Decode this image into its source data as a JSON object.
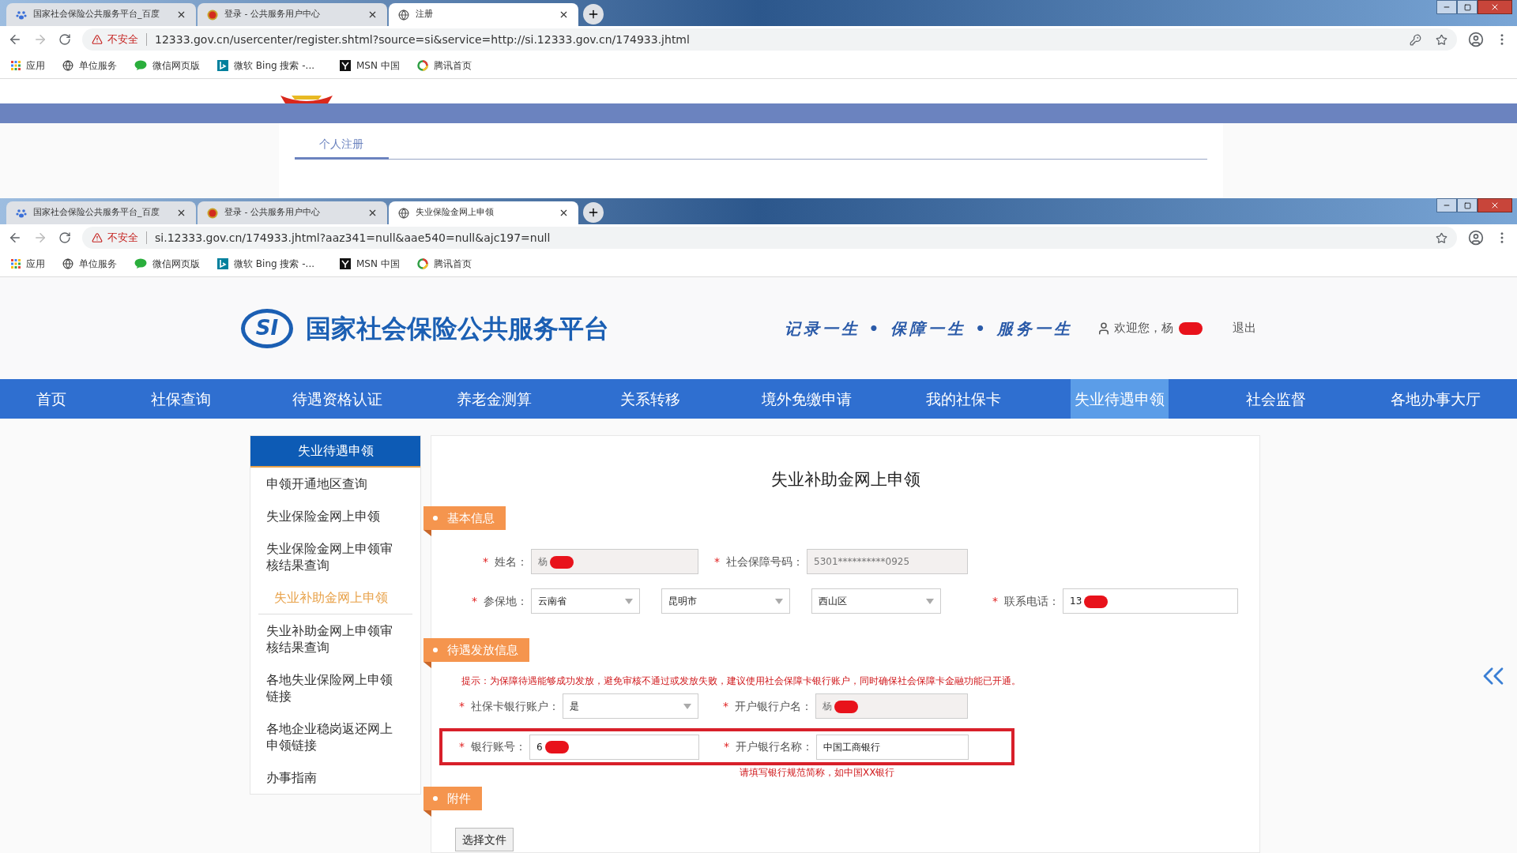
{
  "windows": [
    {
      "tabs": [
        {
          "title": "国家社会保险公共服务平台_百度",
          "selected": false
        },
        {
          "title": "登录 - 公共服务用户中心",
          "selected": false
        },
        {
          "title": "注册",
          "selected": true
        }
      ],
      "address_bar": {
        "security": "不安全",
        "url": "12333.gov.cn/usercenter/register.shtml?source=si&service=http://si.12333.gov.cn/174933.jhtml"
      },
      "bookmarks": [
        "应用",
        "单位服务",
        "微信网页版",
        "微软 Bing 搜索 -...",
        "MSN 中国",
        "腾讯首页"
      ],
      "page": {
        "tabs": [
          {
            "label": "个人注册",
            "selected": true
          }
        ]
      }
    },
    {
      "tabs": [
        {
          "title": "国家社会保险公共服务平台_百度",
          "selected": false
        },
        {
          "title": "登录 - 公共服务用户中心",
          "selected": false
        },
        {
          "title": "失业保险金网上申领",
          "selected": true
        }
      ],
      "address_bar": {
        "security": "不安全",
        "url": "si.12333.gov.cn/174933.jhtml?aaz341=null&aae540=null&ajc197=null"
      },
      "bookmarks": [
        "应用",
        "单位服务",
        "微信网页版",
        "微软 Bing 搜索 -...",
        "MSN 中国",
        "腾讯首页"
      ]
    }
  ],
  "site": {
    "logo": "SI",
    "name": "国家社会保险公共服务平台",
    "slogan": "记录一生 • 保障一生 • 服务一生",
    "welcome": "欢迎您，杨",
    "logout": "退出",
    "nav": [
      {
        "label": "首页",
        "selected": false
      },
      {
        "label": "社保查询",
        "selected": false
      },
      {
        "label": "待遇资格认证",
        "selected": false
      },
      {
        "label": "养老金测算",
        "selected": false
      },
      {
        "label": "关系转移",
        "selected": false
      },
      {
        "label": "境外免缴申请",
        "selected": false
      },
      {
        "label": "我的社保卡",
        "selected": false
      },
      {
        "label": "失业待遇申领",
        "selected": true
      },
      {
        "label": "社会监督",
        "selected": false
      },
      {
        "label": "各地办事大厅",
        "selected": false
      }
    ]
  },
  "sidebar": {
    "title": "失业待遇申领",
    "items": [
      {
        "label": "申领开通地区查询",
        "selected": false
      },
      {
        "label": "失业保险金网上申领",
        "selected": false
      },
      {
        "label": "失业保险金网上申领审核结果查询",
        "selected": false
      },
      {
        "label": "失业补助金网上申领",
        "selected": true
      },
      {
        "label": "失业补助金网上申领审核结果查询",
        "selected": false
      },
      {
        "label": "各地失业保险网上申领链接",
        "selected": false
      },
      {
        "label": "各地企业稳岗返还网上申领链接",
        "selected": false
      },
      {
        "label": "办事指南",
        "selected": false
      }
    ]
  },
  "form": {
    "title": "失业补助金网上申领",
    "basic": {
      "section": "基本信息",
      "name": {
        "mark": "*",
        "label": "姓名：",
        "value": "杨",
        "redacted": true
      },
      "ssn": {
        "mark": "*",
        "label": "社会保障号码：",
        "value": "5301**********0925"
      },
      "region": {
        "mark": "*",
        "label": "参保地：",
        "province": "云南省",
        "city": "昆明市",
        "district": "西山区"
      },
      "phone": {
        "mark": "*",
        "label": "联系电话：",
        "value": "13",
        "redacted": true
      }
    },
    "payment": {
      "section": "待遇发放信息",
      "hint": "提示：为保障待遇能够成功发放，避免审核不通过或发放失败，建议使用社会保障卡银行账户，同时确保社会保障卡金融功能已开通。",
      "card_account": {
        "mark": "*",
        "label": "社保卡银行账户：",
        "value": "是"
      },
      "holder": {
        "mark": "*",
        "label": "开户银行户名：",
        "value": "杨",
        "redacted": true
      },
      "account": {
        "mark": "*",
        "label": "银行账号：",
        "value": "6",
        "redacted": true
      },
      "bank": {
        "mark": "*",
        "label": "开户银行名称：",
        "value": "中国工商银行",
        "hint": "请填写银行规范简称，如中国XX银行"
      },
      "highlighted": true
    },
    "attachments": {
      "section": "附件",
      "button": "选择文件"
    }
  }
}
